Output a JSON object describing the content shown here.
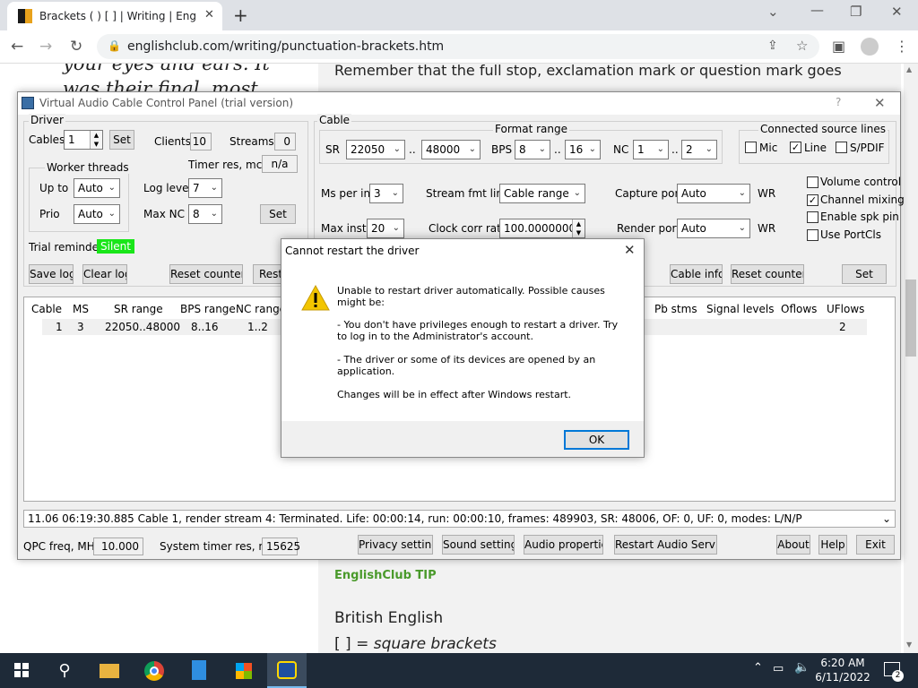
{
  "browser": {
    "tab_title": "Brackets ( ) [ ] | Writing | EnglishC",
    "url": "englishclub.com/writing/punctuation-brackets.htm"
  },
  "webpage": {
    "italic_left_line1": "your eyes and ears. It",
    "italic_left_line2": "was their final, most",
    "intro": "Remember that the full stop, exclamation mark or question mark goes",
    "tip": "EnglishClub TIP",
    "heading": "British English",
    "bracket_sym": "[ ] = ",
    "bracket_term": "square brackets"
  },
  "vac": {
    "title": "Virtual Audio Cable Control Panel (trial version)",
    "help": "?",
    "driver": {
      "group": "Driver",
      "cables_label": "Cables",
      "cables_value": "1",
      "set": "Set",
      "clients_label": "Clients",
      "clients_value": "10",
      "streams_label": "Streams",
      "streams_value": "0",
      "worker_group": "Worker threads",
      "upto_label": "Up to",
      "upto_value": "Auto",
      "prio_label": "Prio",
      "prio_value": "Auto",
      "timer_label": "Timer res, mcs",
      "timer_value": "n/a",
      "loglevel_label": "Log level",
      "loglevel_value": "7",
      "maxnc_label": "Max NC",
      "maxnc_value": "8",
      "set2": "Set",
      "trial_label": "Trial reminder",
      "trial_value": "Silent",
      "save_log": "Save log",
      "clear_log": "Clear log",
      "reset_counters": "Reset counters",
      "restart": "Resta"
    },
    "cable": {
      "group": "Cable",
      "format_range": "Format range",
      "sr_label": "SR",
      "sr_min": "22050",
      "sr_max": "48000",
      "bps_label": "BPS",
      "bps_min": "8",
      "bps_max": "16",
      "nc_label": "NC",
      "nc_min": "1",
      "nc_max": "2",
      "dots": "..",
      "connected": "Connected source lines",
      "mic": "Mic",
      "line": "Line",
      "spdif": "S/PDIF",
      "ms_label": "Ms per int",
      "ms_value": "3",
      "stream_fmt_label": "Stream fmt limit",
      "stream_fmt_value": "Cable range",
      "capture_label": "Capture port",
      "capture_value": "Auto",
      "wr1": "WR",
      "maxinst_label": "Max inst",
      "maxinst_value": "20",
      "clock_label": "Clock corr ratio",
      "clock_value": "100.0000000",
      "render_label": "Render port",
      "render_value": "Auto",
      "wr2": "WR",
      "volume_control": "Volume control",
      "channel_mixing": "Channel mixing",
      "enable_spk": "Enable spk pin",
      "use_portcls": "Use PortCls",
      "cable_info": "Cable info",
      "reset_counters": "Reset counters",
      "set": "Set"
    },
    "table": {
      "headers": [
        "Cable",
        "MS",
        "SR range",
        "BPS range",
        "NC range",
        "Pb stms",
        "Signal levels",
        "Oflows",
        "UFlows"
      ],
      "row": [
        "1",
        "3",
        "22050..48000",
        "8..16",
        "1..2",
        "2"
      ]
    },
    "status": "11.06   06:19:30.885  Cable 1, render stream 4: Terminated. Life: 00:00:14, run: 00:00:10, frames: 489903, SR: 48006, OF: 0, UF: 0, modes: L/N/P",
    "bottom": {
      "qpc_label": "QPC freq, MHz",
      "qpc_value": "10.000",
      "sys_label": "System timer res, mcs",
      "sys_value": "15625",
      "privacy": "Privacy settings",
      "sound": "Sound settings",
      "audio_props": "Audio properties",
      "restart_audio": "Restart Audio Service",
      "about": "About",
      "help": "Help",
      "exit": "Exit"
    }
  },
  "dialog": {
    "title": "Cannot restart the driver",
    "msg1": "Unable to restart driver automatically. Possible causes might be:",
    "msg2": "- You don't have privileges enough to restart a driver. Try to log in to the Administrator's account.",
    "msg3": "- The driver or some of its devices are opened by an application.",
    "msg4": "Changes will be in effect after Windows restart.",
    "ok": "OK"
  },
  "taskbar": {
    "time": "6:20 AM",
    "date": "6/11/2022",
    "notif_count": "2"
  }
}
